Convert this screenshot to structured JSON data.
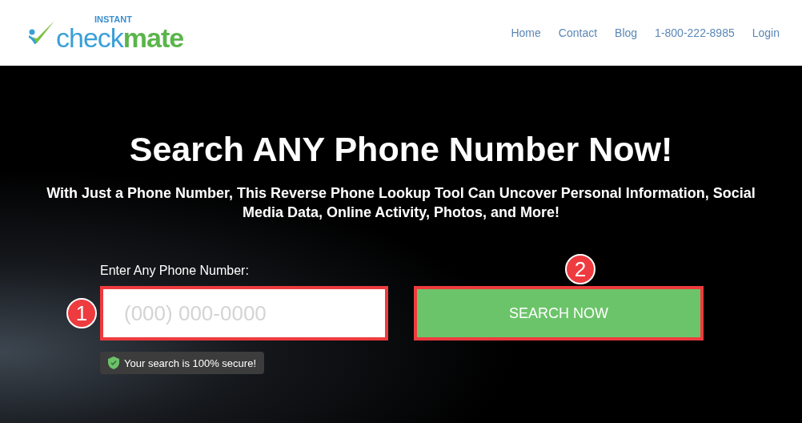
{
  "logo": {
    "small": "INSTANT",
    "word_1": "check",
    "word_2": "mate"
  },
  "nav": [
    "Home",
    "Contact",
    "Blog",
    "1-800-222-8985",
    "Login"
  ],
  "hero": {
    "title": "Search ANY Phone Number Now!",
    "subtitle": "With Just a Phone Number, This Reverse Phone Lookup Tool Can Uncover Personal Information, Social Media Data, Online Activity, Photos, and More!"
  },
  "form": {
    "label": "Enter Any Phone Number:",
    "placeholder": "(000) 000-0000",
    "button": "SEARCH NOW",
    "secure_note": "Your search is 100% secure!"
  },
  "annotations": [
    "1",
    "2"
  ]
}
